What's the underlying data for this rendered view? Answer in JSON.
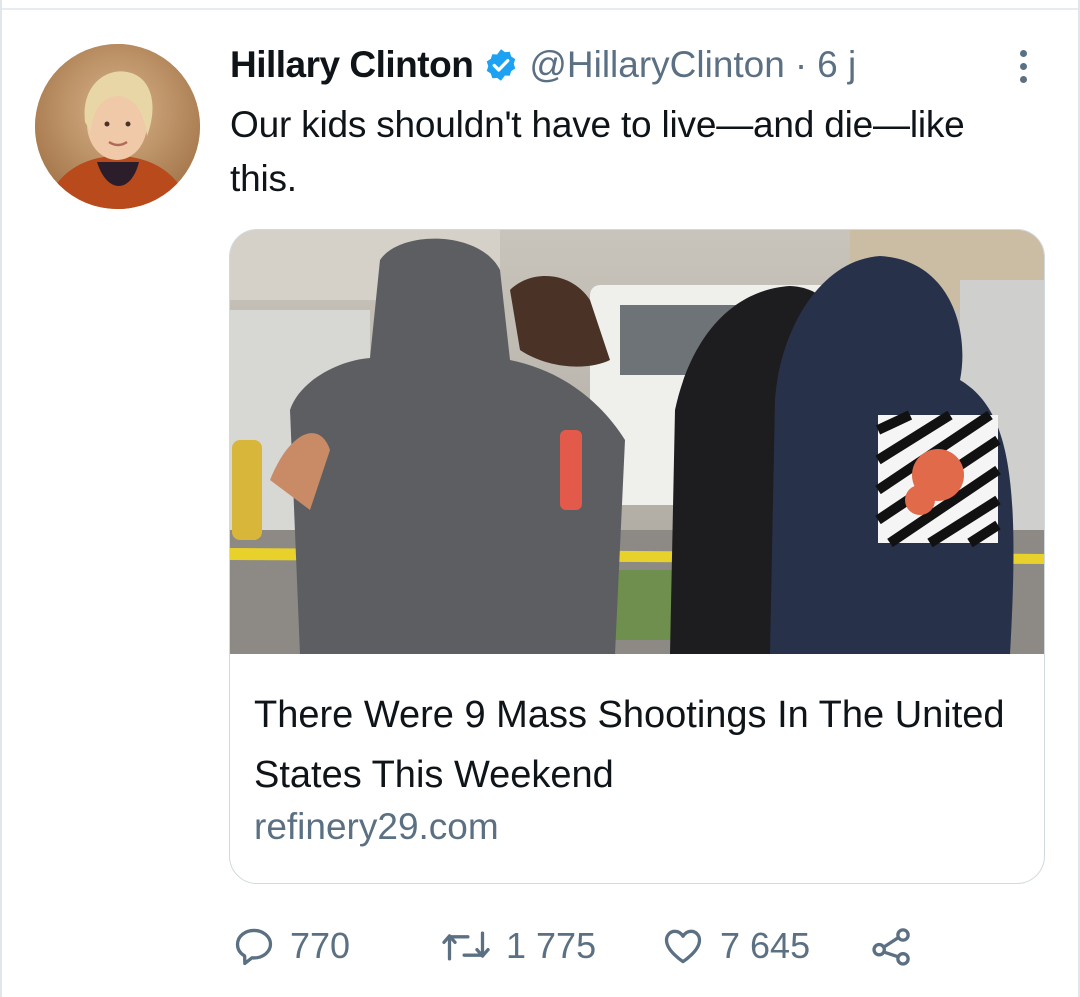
{
  "tweet": {
    "author_name": "Hillary Clinton",
    "handle": "@HillaryClinton",
    "separator": "·",
    "time": "6 j",
    "text": "Our kids shouldn't have to live—and die—like this."
  },
  "card": {
    "title": "There Were 9 Mass Shootings In The United States This Weekend",
    "domain": "refinery29.com"
  },
  "actions": {
    "replies": "770",
    "retweets": "1 775",
    "likes": "7 645"
  },
  "icons": {
    "verified": "verified-badge-icon",
    "more": "more-vertical-icon",
    "reply": "reply-icon",
    "retweet": "retweet-icon",
    "like": "heart-icon",
    "share": "share-icon"
  },
  "colors": {
    "verified": "#1da1f2",
    "secondary_text": "#5b7083",
    "card_border": "#cfd9de"
  }
}
